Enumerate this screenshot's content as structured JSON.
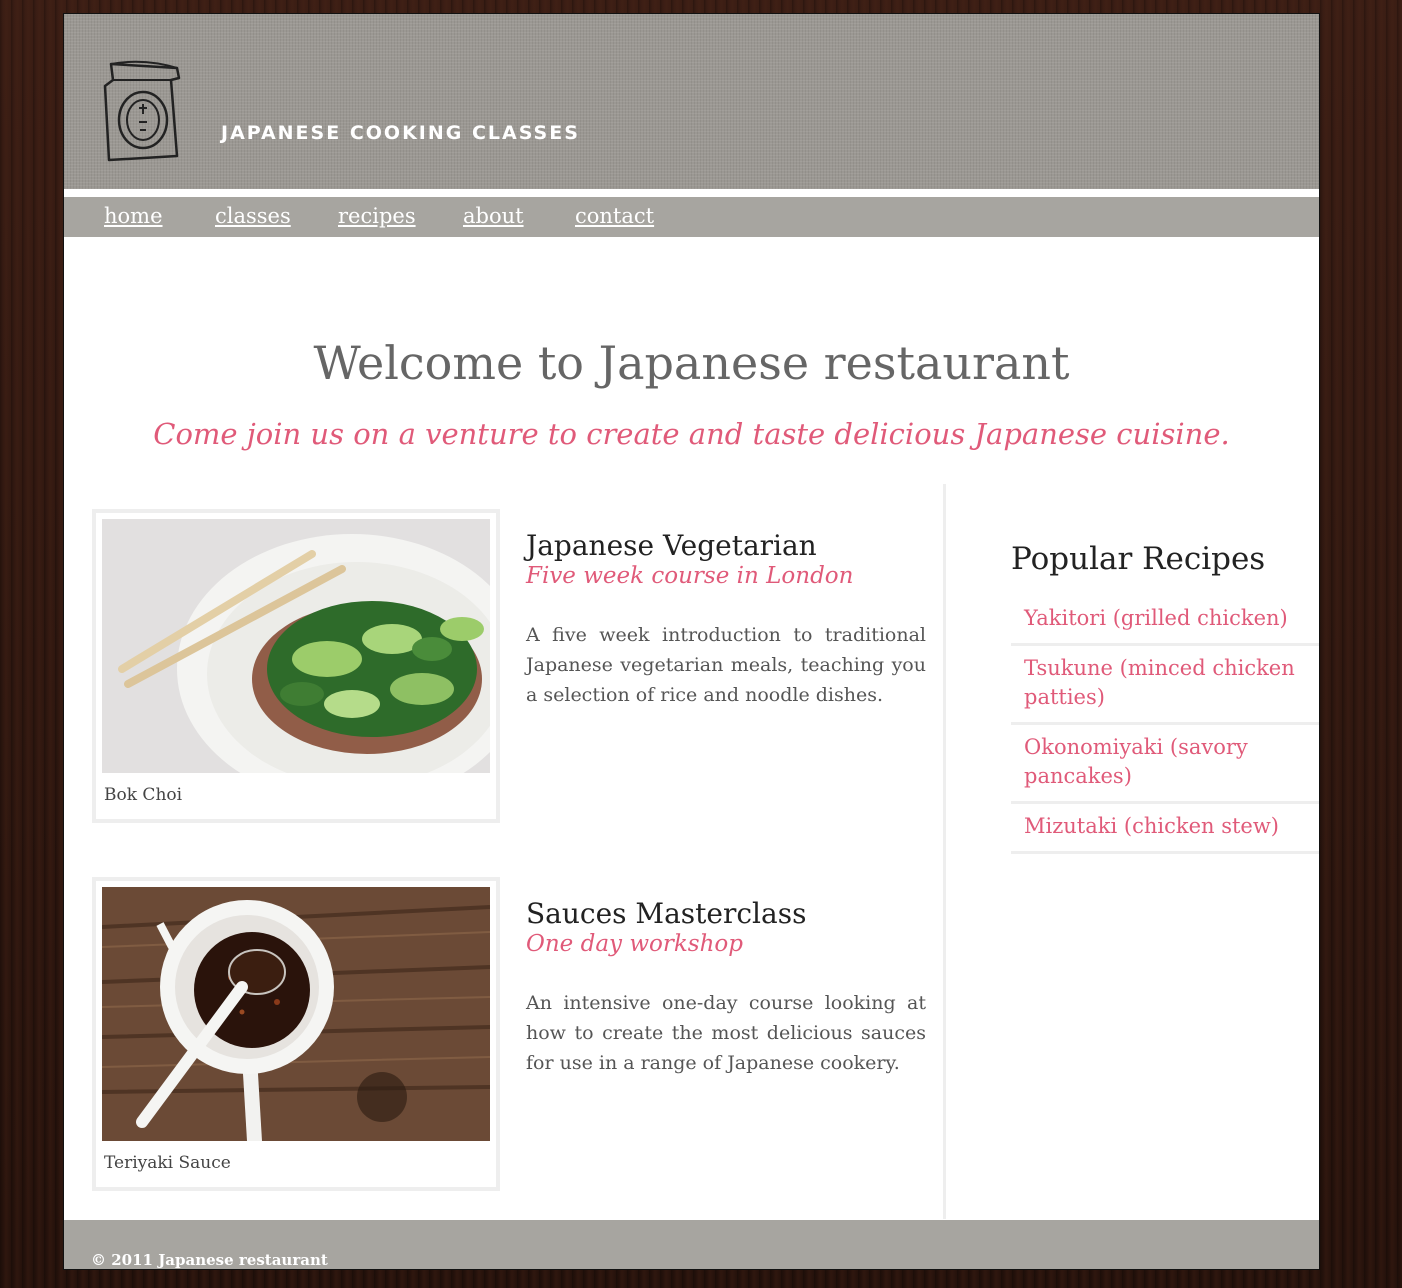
{
  "header": {
    "site_title": "JAPANESE COOKING CLASSES",
    "logo_icon": "bag-logo-icon"
  },
  "nav": {
    "items": [
      {
        "label": "home"
      },
      {
        "label": "classes"
      },
      {
        "label": "recipes"
      },
      {
        "label": "about"
      },
      {
        "label": "contact"
      }
    ]
  },
  "main": {
    "welcome": "Welcome to Japanese restaurant",
    "tagline": "Come join us on a venture to create and taste delicious Japanese cuisine.",
    "classes": [
      {
        "title": "Japanese Vegetarian",
        "subtitle": "Five week course in London",
        "description": "A five week introduction to traditional Japanese vegetarian meals, teaching you a selection of rice and noodle dishes.",
        "image_caption": "Bok Choi"
      },
      {
        "title": "Sauces Masterclass",
        "subtitle": "One day workshop",
        "description": "An intensive one-day course looking at how to create the most delicious sauces for use in a range of Japanese cookery.",
        "image_caption": "Teriyaki Sauce"
      }
    ]
  },
  "sidebar": {
    "title": "Popular Recipes",
    "recipes": [
      {
        "label": "Yakitori (grilled chicken)"
      },
      {
        "label": "Tsukune (minced chicken patties)"
      },
      {
        "label": "Okonomiyaki (savory pancakes)"
      },
      {
        "label": "Mizutaki (chicken stew)"
      }
    ]
  },
  "footer": {
    "copyright": "© 2011 Japanese restaurant"
  },
  "colors": {
    "accent": "#e05a79",
    "nav_bg": "#a7a5a0",
    "header_bg": "#9b9893",
    "frame_bg": "#2b1610"
  }
}
